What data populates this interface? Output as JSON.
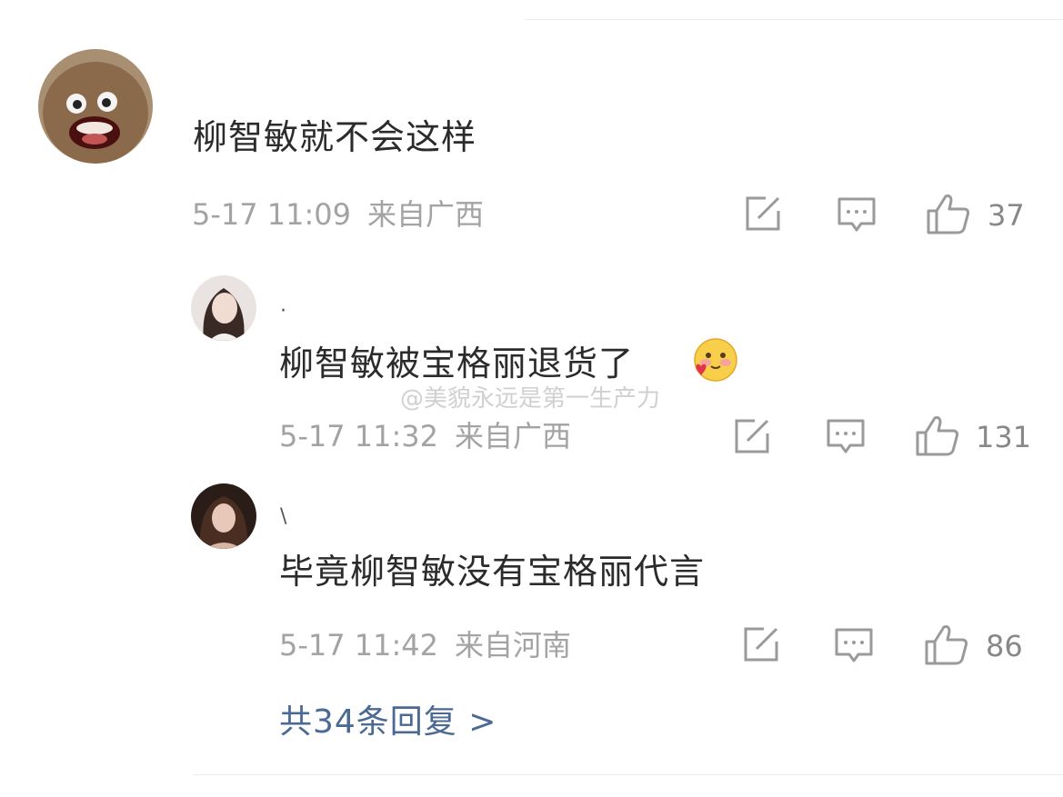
{
  "comment": {
    "text": "柳智敏就不会这样",
    "time": "5-17 11:09",
    "location": "来自广西",
    "like_count": "37",
    "avatar_icon": "cartoon-face-avatar-icon"
  },
  "replies": [
    {
      "username": "·",
      "text": "柳智敏被宝格丽退货了",
      "emoji": "blushing-heart-emoji",
      "time": "5-17 11:32",
      "location": "来自广西",
      "like_count": "131"
    },
    {
      "username": "\\",
      "text": "毕竟柳智敏没有宝格丽代言",
      "time": "5-17 11:42",
      "location": "来自河南",
      "like_count": "86"
    }
  ],
  "more_replies_label": "共34条回复 >",
  "watermark": "@美貌永远是第一生产力",
  "colors": {
    "text": "#2b2b2b",
    "meta": "#a3a3a3",
    "link": "#4a6a93",
    "icon": "#9a9a9a"
  },
  "icons": [
    "share-edit-icon",
    "comment-icon",
    "like-thumb-icon"
  ]
}
